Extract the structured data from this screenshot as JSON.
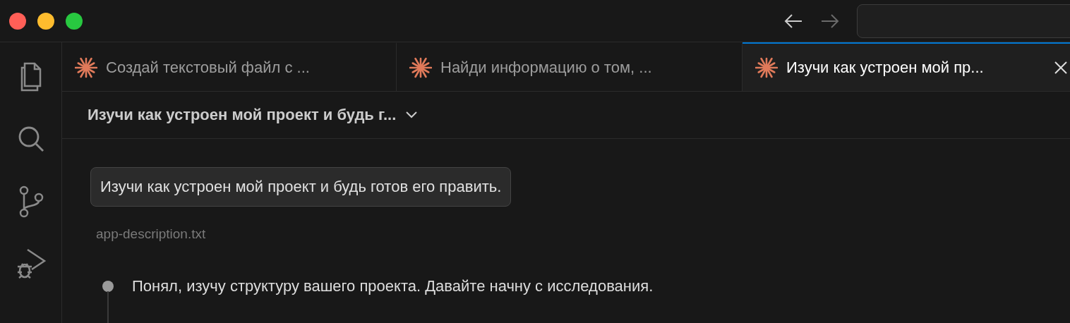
{
  "activity_bar": [
    {
      "kind": "files",
      "selected": false
    },
    {
      "kind": "search",
      "selected": false
    },
    {
      "kind": "source-control",
      "selected": false
    },
    {
      "kind": "run-debug",
      "selected": false
    }
  ],
  "tabs": [
    {
      "label": "Создай текстовый файл с ...",
      "selected": false
    },
    {
      "label": "Найди информацию о том, ...",
      "selected": false
    },
    {
      "label": "Изучи как устроен мой пр...",
      "selected": true
    }
  ],
  "header": {
    "title": "Изучи как устроен мой проект и будь г..."
  },
  "chat": {
    "user_message": "Изучи как устроен мой проект и будь готов его править.",
    "attachment": "app-description.txt",
    "steps": [
      {
        "text": "Понял, изучу структуру вашего проекта. Давайте начну с исследования."
      }
    ]
  }
}
